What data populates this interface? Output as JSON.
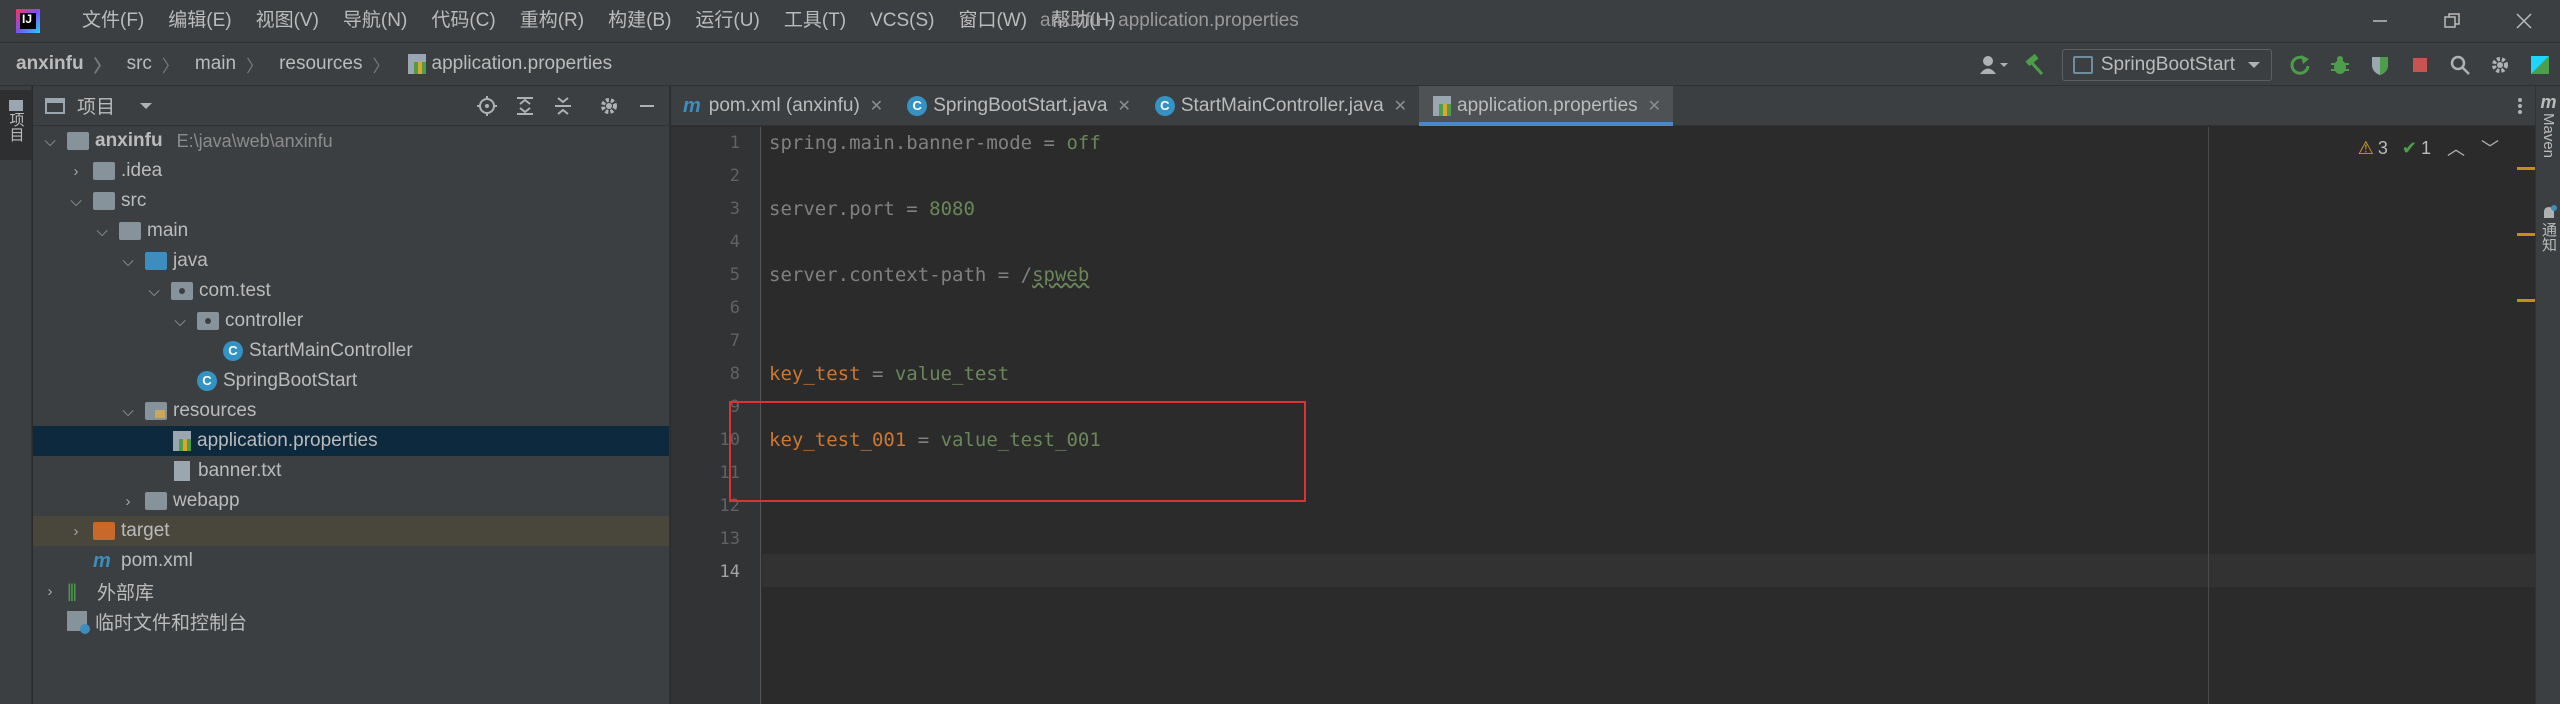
{
  "titlebar": {
    "menu": [
      "文件(F)",
      "编辑(E)",
      "视图(V)",
      "导航(N)",
      "代码(C)",
      "重构(R)",
      "构建(B)",
      "运行(U)",
      "工具(T)",
      "VCS(S)",
      "窗口(W)",
      "帮助(H)"
    ],
    "window_title": "anxinfu - application.properties"
  },
  "breadcrumb": [
    "anxinfu",
    "src",
    "main",
    "resources",
    "application.properties"
  ],
  "toolbar": {
    "run_config": "SpringBootStart"
  },
  "left_stripe": {
    "project_tab": "项目"
  },
  "project_panel": {
    "title": "项目",
    "tree": [
      {
        "label": "anxinfu",
        "hint": "E:\\java\\web\\anxinfu"
      },
      {
        "label": ".idea"
      },
      {
        "label": "src"
      },
      {
        "label": "main"
      },
      {
        "label": "java"
      },
      {
        "label": "com.test"
      },
      {
        "label": "controller"
      },
      {
        "label": "StartMainController"
      },
      {
        "label": "SpringBootStart"
      },
      {
        "label": "resources"
      },
      {
        "label": "application.properties"
      },
      {
        "label": "banner.txt"
      },
      {
        "label": "webapp"
      },
      {
        "label": "target"
      },
      {
        "label": "pom.xml"
      },
      {
        "label": "外部库"
      },
      {
        "label": "临时文件和控制台"
      }
    ]
  },
  "editor_tabs": [
    {
      "label": "pom.xml (anxinfu)"
    },
    {
      "label": "SpringBootStart.java"
    },
    {
      "label": "StartMainController.java"
    },
    {
      "label": "application.properties"
    }
  ],
  "editor": {
    "line_numbers": [
      "1",
      "2",
      "3",
      "4",
      "5",
      "6",
      "7",
      "8",
      "9",
      "10",
      "11",
      "12",
      "13",
      "14"
    ],
    "lines": {
      "l1_key": "spring.main.banner-mode",
      "l1_eq": " = ",
      "l1_val": "off",
      "l3_key": "server.port",
      "l3_eq": " = ",
      "l3_val": "8080",
      "l5_key": "server.context-path",
      "l5_eq": " = /",
      "l5_val": "spweb",
      "l8_key": "key_test",
      "l8_eq": " = ",
      "l8_val": "value_test",
      "l10_key": "key_test_001",
      "l10_eq": " = ",
      "l10_val": "value_test_001"
    },
    "inspection": {
      "warnings": "3",
      "ok": "1"
    }
  },
  "right_stripe": {
    "maven": "Maven",
    "notifications": "通知"
  }
}
